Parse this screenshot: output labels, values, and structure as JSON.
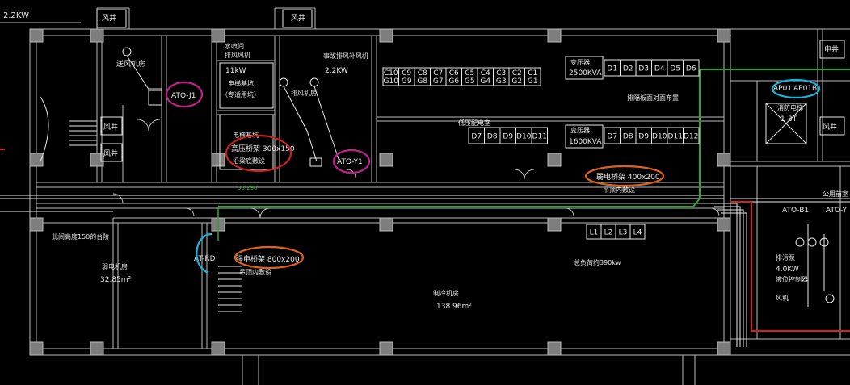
{
  "colors": {
    "background": "#000000",
    "wall": "#bdbdbd",
    "line": "#e8e8e8",
    "tray_green": "#2fa52f",
    "red_line": "#d62020",
    "mark_magenta": "#c0208a",
    "mark_red": "#cc2020",
    "mark_cyan": "#19b7e3",
    "mark_orange": "#e0621a"
  },
  "texts": {
    "top_power": "2.2KW",
    "fengjing_1": "风井",
    "fengjing_2": "风井",
    "fengjing_3": "风井",
    "fengjing_4": "风井",
    "fengjing_5": "风井",
    "fengjing_6": "风井",
    "fan_label": "送风机房",
    "ato_j1": "ATO-J1",
    "water_room": "水喷间",
    "exhaust_room": "排风风机",
    "power_11kw": "11kW",
    "elevator_1": "电梯基坑",
    "elevator_2": "（专适用坑）",
    "smoke_fan": "事故排风补风机",
    "smoke_power": "2.2KW",
    "exhaust_fan": "排风机房",
    "cable_shaft": "电梯基坑",
    "trunk_1": "高压桥架 300x150",
    "trunk_2": "沿梁底敷设",
    "ato_y1": "ATO-Y1",
    "transformer_1": "变压器",
    "transformer_1_kva": "2500KVA",
    "transformer_2": "变压器",
    "transformer_2_kva": "1600KVA",
    "lv_room": "低压配电室",
    "note_layout": "排隔板面对面布置",
    "ap01": "AP01",
    "ap01b": "AP01B",
    "fire_elevator": "消防电梯",
    "lift_code": "1-3T",
    "tray_400": "弱电桥架 400x200",
    "tray_400_sub": "吊顶内敷设",
    "level": "33.290",
    "step_note": "此间高度150的台阶",
    "weak_room": "弱电机房",
    "weak_area": "32.85m²",
    "at_rd": "AT-RD",
    "tray_800": "强电桥架 800x200",
    "tray_800_sub": "吊顶内敷设",
    "total_load": "总负荷约390kw",
    "cold_room": "制冷机房",
    "cold_area": "138.96m²",
    "public_room": "公用前室",
    "ato_b1": "ATO-B1",
    "ato_y_right": "ATO-Y",
    "pump_room": "排污泵",
    "pump_power": "4.0KW",
    "pump_ctrl": "液位控制器",
    "upper_room": "风机",
    "right_ele": "电井"
  },
  "cabinets_top": [
    "C10\nG10",
    "C9\nG9",
    "C8\nG8",
    "C7\nG7",
    "C6\nG6",
    "C5\nG5",
    "C4\nG4",
    "C3\nG3",
    "C2\nG2",
    "C1\nG1"
  ],
  "cabinets_d_top": [
    "D1",
    "D2",
    "D3",
    "D4",
    "D5",
    "D6"
  ],
  "cabinets_d_mid_left": [
    "D7",
    "D8",
    "D9",
    "D10",
    "D11"
  ],
  "cabinets_d_mid_right": [
    "D7",
    "D8",
    "D9",
    "D10",
    "D11",
    "D12"
  ],
  "cabinets_l": [
    "L1",
    "L2",
    "L3",
    "L4"
  ]
}
